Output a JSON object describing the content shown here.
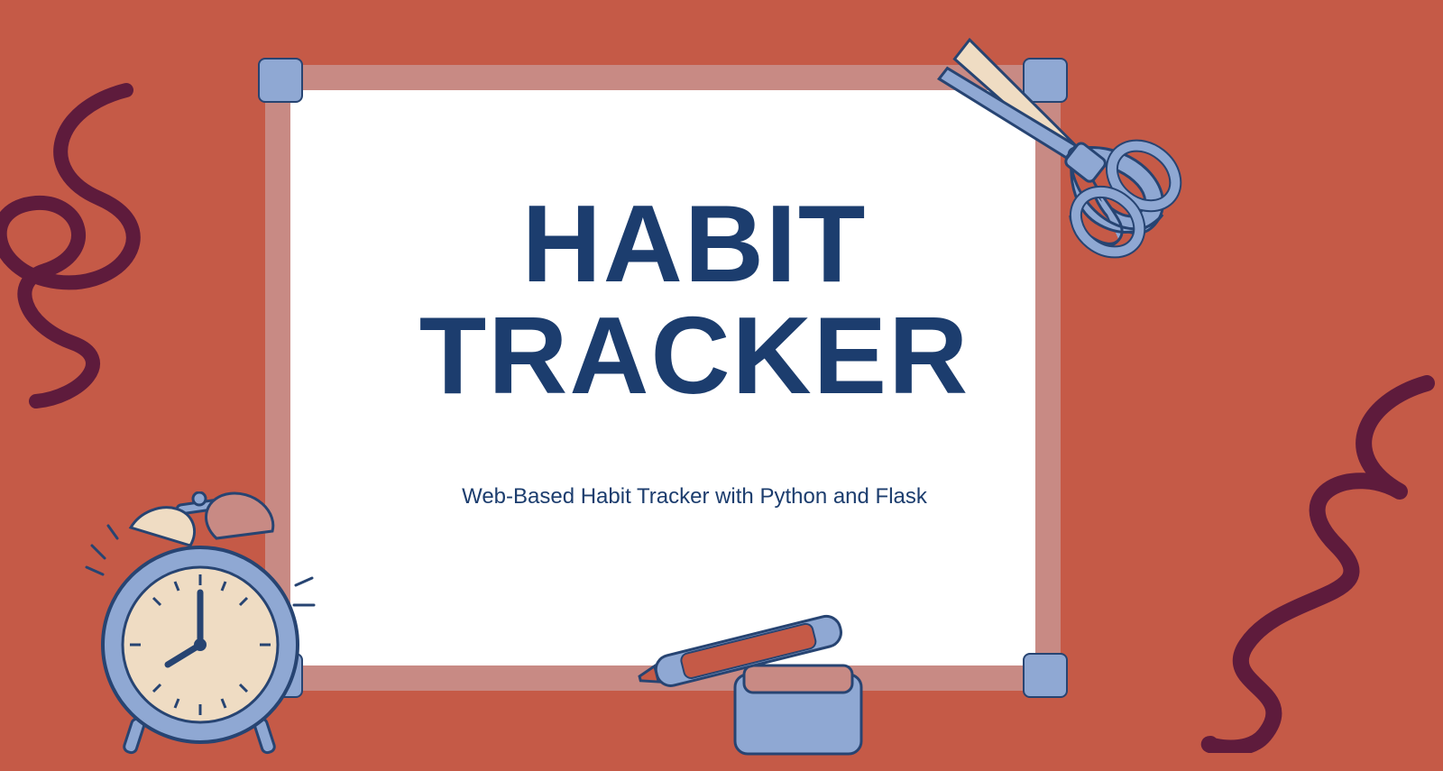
{
  "title_line1": "HABIT",
  "title_line2": "TRACKER",
  "subtitle": "Web-Based Habit Tracker with Python and Flask",
  "colors": {
    "background": "#C55A47",
    "frame": "#C88A84",
    "corner": "#8FA8D3",
    "text": "#1C3D6E",
    "scribble": "#5E1B3C",
    "clock_body": "#8FA8D3",
    "clock_face": "#EFDCC3"
  },
  "icons": {
    "clock": "alarm-clock-icon",
    "scissors": "scissors-icon",
    "marker": "marker-icon",
    "scribble_left": "squiggle-icon",
    "scribble_right": "squiggle-icon"
  }
}
